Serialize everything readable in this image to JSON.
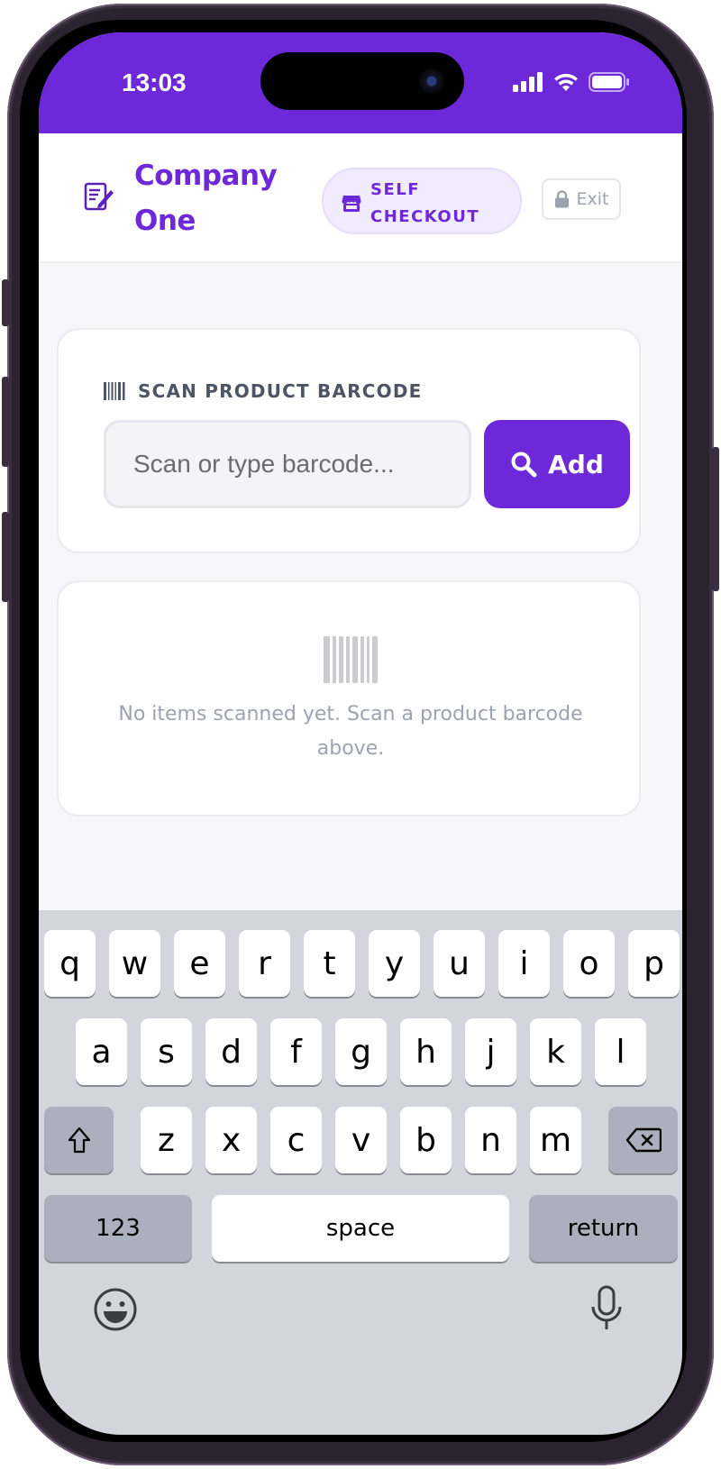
{
  "status_bar": {
    "time": "13:03"
  },
  "header": {
    "brand_name": "Company One",
    "mode_label": "SELF CHECKOUT",
    "exit_label": "Exit"
  },
  "scan": {
    "label": "SCAN PRODUCT BARCODE",
    "input_placeholder": "Scan or type barcode...",
    "input_value": "",
    "add_label": "Add"
  },
  "empty_state": {
    "message": "No items scanned yet. Scan a product barcode above."
  },
  "keyboard": {
    "row1": [
      "q",
      "w",
      "e",
      "r",
      "t",
      "y",
      "u",
      "i",
      "o",
      "p"
    ],
    "row2": [
      "a",
      "s",
      "d",
      "f",
      "g",
      "h",
      "j",
      "k",
      "l"
    ],
    "row3": [
      "z",
      "x",
      "c",
      "v",
      "b",
      "n",
      "m"
    ],
    "numbers_label": "123",
    "space_label": "space",
    "return_label": "return"
  },
  "colors": {
    "brand": "#6d28d9",
    "brand_tint": "#f1ecfd",
    "muted_text": "#9ca3af"
  }
}
